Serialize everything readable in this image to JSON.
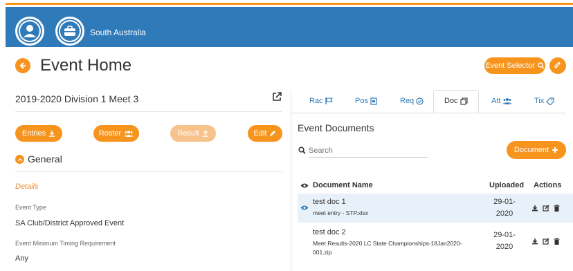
{
  "header": {
    "org_name": "South Australia",
    "user_icon": "user-icon",
    "org_icon": "briefcase-icon"
  },
  "page": {
    "title": "Event Home",
    "event_selector_label": "Event Selector",
    "attach_icon": "paperclip-icon"
  },
  "meet": {
    "title": "2019-2020 Division 1 Meet 3",
    "buttons": {
      "entries": "Entries",
      "roster": "Roster",
      "result": "Result",
      "edit": "Edit"
    },
    "general_label": "General",
    "details_label": "Details",
    "fields": [
      {
        "label": "Event Type",
        "value": "SA Club/District Approved Event"
      },
      {
        "label": "Event Minimum Timing Requirement",
        "value": "Any"
      }
    ]
  },
  "tabs": [
    {
      "label": "Rac",
      "icon": "flag-icon"
    },
    {
      "label": "Pos",
      "icon": "poster-icon"
    },
    {
      "label": "Req",
      "icon": "check-circle-icon"
    },
    {
      "label": "Doc",
      "icon": "copy-icon",
      "active": true
    },
    {
      "label": "Att",
      "icon": "users-icon"
    },
    {
      "label": "Tix",
      "icon": "ticket-icon"
    }
  ],
  "documents": {
    "title": "Event Documents",
    "search_placeholder": "Search",
    "add_label": "Document",
    "columns": {
      "name": "Document Name",
      "uploaded": "Uploaded",
      "actions": "Actions"
    },
    "rows": [
      {
        "name": "test doc 1",
        "file": "meet entry - STP.xlsx",
        "date_line1": "29-01-",
        "date_line2": "2020",
        "visible": true
      },
      {
        "name": "test doc 2",
        "file_line1": "Meet Results-2020 LC State Championships-18Jan2020-",
        "file_line2": "001.zip",
        "date_line1": "29-01-",
        "date_line2": "2020",
        "visible": false
      }
    ]
  },
  "colors": {
    "accent": "#f7941d",
    "brand_blue": "#2f7ab8",
    "row_highlight": "#e8f1f9"
  }
}
